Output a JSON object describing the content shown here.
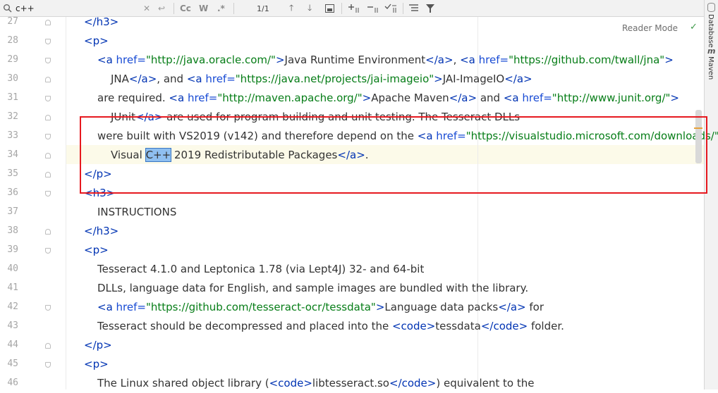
{
  "findbar": {
    "query": "c++",
    "match_case_label": "Cc",
    "words_label": "W",
    "regex_label": ".*",
    "matches": "1/1"
  },
  "right_strip": {
    "database": "Database",
    "maven": "Maven"
  },
  "editor": {
    "reader_mode": "Reader Mode",
    "line_numbers": [
      "27",
      "28",
      "29",
      "30",
      "31",
      "32",
      "33",
      "34",
      "35",
      "36",
      "37",
      "38",
      "39",
      "40",
      "41",
      "42",
      "43",
      "44",
      "45",
      "46"
    ],
    "lines": {
      "l27_close": "</h3>",
      "l28_p": "<p>",
      "l29_a_open": "<a ",
      "l29_href": "href=",
      "l29_url": "\"http://java.oracle.com/\"",
      "l29_gt": ">",
      "l29_text": "Java Runtime Environment",
      "l29_a_close": "</a>",
      "l29_comma": ", ",
      "l29_a_open2": "<a ",
      "l29_href2": "href=",
      "l29_url2": "\"https://github.com/twall/jna\"",
      "l29_gt2": ">",
      "l30_text1": "JNA",
      "l30_a_close": "</a>",
      "l30_and": ", and ",
      "l30_a_open": "<a ",
      "l30_href": "href=",
      "l30_url": "\"https://java.net/projects/jai-imageio\"",
      "l30_gt": ">",
      "l30_text2": "JAI-ImageIO",
      "l30_a_close2": "</a>",
      "l31_text1": "are required. ",
      "l31_a_open": "<a ",
      "l31_href": "href=",
      "l31_url": "\"http://maven.apache.org/\"",
      "l31_gt": ">",
      "l31_text2": "Apache Maven",
      "l31_a_close": "</a>",
      "l31_and": " and ",
      "l31_a_open2": "<a ",
      "l31_href2": "href=",
      "l31_url2": "\"http://www.junit.org/\"",
      "l31_gt2": ">",
      "l32_text1": "JUnit",
      "l32_a_close": "</a>",
      "l32_text2": " are used for program building and unit testing. The Tesseract DLLs",
      "l33_text": "were built with VS2019 (v142) and therefore depend on the ",
      "l33_a_open": "<a ",
      "l33_href": "href=",
      "l33_url": "\"https://visualstudio.microsoft.com/downloads/\"",
      "l33_gt": ">",
      "l34_pre": "Visual ",
      "l34_match": "C++",
      "l34_post": " 2019 Redistributable Packages",
      "l34_a_close": "</a>",
      "l34_dot": ".",
      "l35_close_p": "</p>",
      "l36_h3": "<h3>",
      "l37_text": "INSTRUCTIONS",
      "l38_close_h3": "</h3>",
      "l39_p": "<p>",
      "l40_text": "Tesseract 4.1.0 and Leptonica 1.78 (via Lept4J) 32- and 64-bit",
      "l41_text": "DLLs, language data for English, and sample images are bundled with the library.",
      "l42_a_open": "<a ",
      "l42_href": "href=",
      "l42_url": "\"https://github.com/tesseract-ocr/tessdata\"",
      "l42_gt": ">",
      "l42_text": "Language data packs",
      "l42_a_close": "</a>",
      "l42_for": " for",
      "l43_text1": "Tesseract should be decompressed and placed into the ",
      "l43_code_open": "<code>",
      "l43_text2": "tessdata",
      "l43_code_close": "</code>",
      "l43_text3": " folder.",
      "l44_close_p": "</p>",
      "l45_p": "<p>",
      "l46_text1": "The Linux shared object library (",
      "l46_code_open": "<code>",
      "l46_text2": "libtesseract.so",
      "l46_code_close": "</code>",
      "l46_text3": ") equivalent to the"
    }
  }
}
